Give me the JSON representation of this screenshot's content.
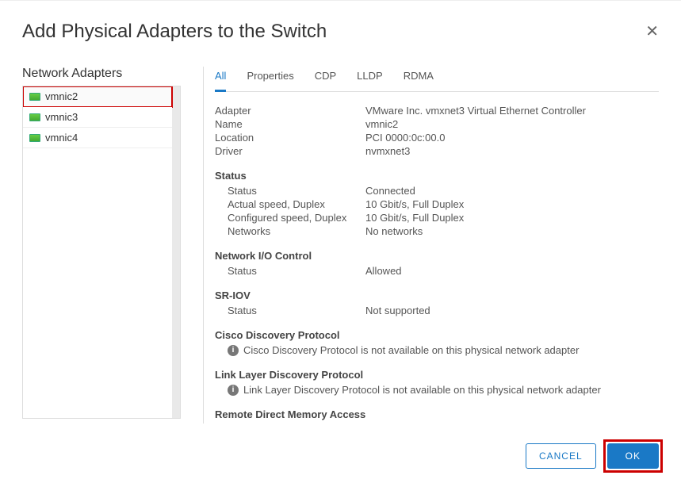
{
  "dialog": {
    "title": "Add Physical Adapters to the Switch"
  },
  "left": {
    "heading": "Network Adapters",
    "items": [
      {
        "label": "vmnic2",
        "selected": true
      },
      {
        "label": "vmnic3",
        "selected": false
      },
      {
        "label": "vmnic4",
        "selected": false
      }
    ]
  },
  "tabs": [
    {
      "label": "All",
      "active": true
    },
    {
      "label": "Properties",
      "active": false
    },
    {
      "label": "CDP",
      "active": false
    },
    {
      "label": "LLDP",
      "active": false
    },
    {
      "label": "RDMA",
      "active": false
    }
  ],
  "details": {
    "general": {
      "adapter_k": "Adapter",
      "adapter_v": "VMware Inc. vmxnet3 Virtual Ethernet Controller",
      "name_k": "Name",
      "name_v": "vmnic2",
      "location_k": "Location",
      "location_v": "PCI 0000:0c:00.0",
      "driver_k": "Driver",
      "driver_v": "nvmxnet3"
    },
    "status": {
      "heading": "Status",
      "status_k": "Status",
      "status_v": "Connected",
      "actual_k": "Actual speed, Duplex",
      "actual_v": "10 Gbit/s, Full Duplex",
      "conf_k": "Configured speed, Duplex",
      "conf_v": "10 Gbit/s, Full Duplex",
      "nets_k": "Networks",
      "nets_v": "No networks"
    },
    "nioc": {
      "heading": "Network I/O Control",
      "status_k": "Status",
      "status_v": "Allowed"
    },
    "sriov": {
      "heading": "SR-IOV",
      "status_k": "Status",
      "status_v": "Not supported"
    },
    "cdp": {
      "heading": "Cisco Discovery Protocol",
      "msg": "Cisco Discovery Protocol is not available on this physical network adapter"
    },
    "lldp": {
      "heading": "Link Layer Discovery Protocol",
      "msg": "Link Layer Discovery Protocol is not available on this physical network adapter"
    },
    "rdma": {
      "heading": "Remote Direct Memory Access"
    }
  },
  "footer": {
    "cancel": "CANCEL",
    "ok": "OK"
  }
}
